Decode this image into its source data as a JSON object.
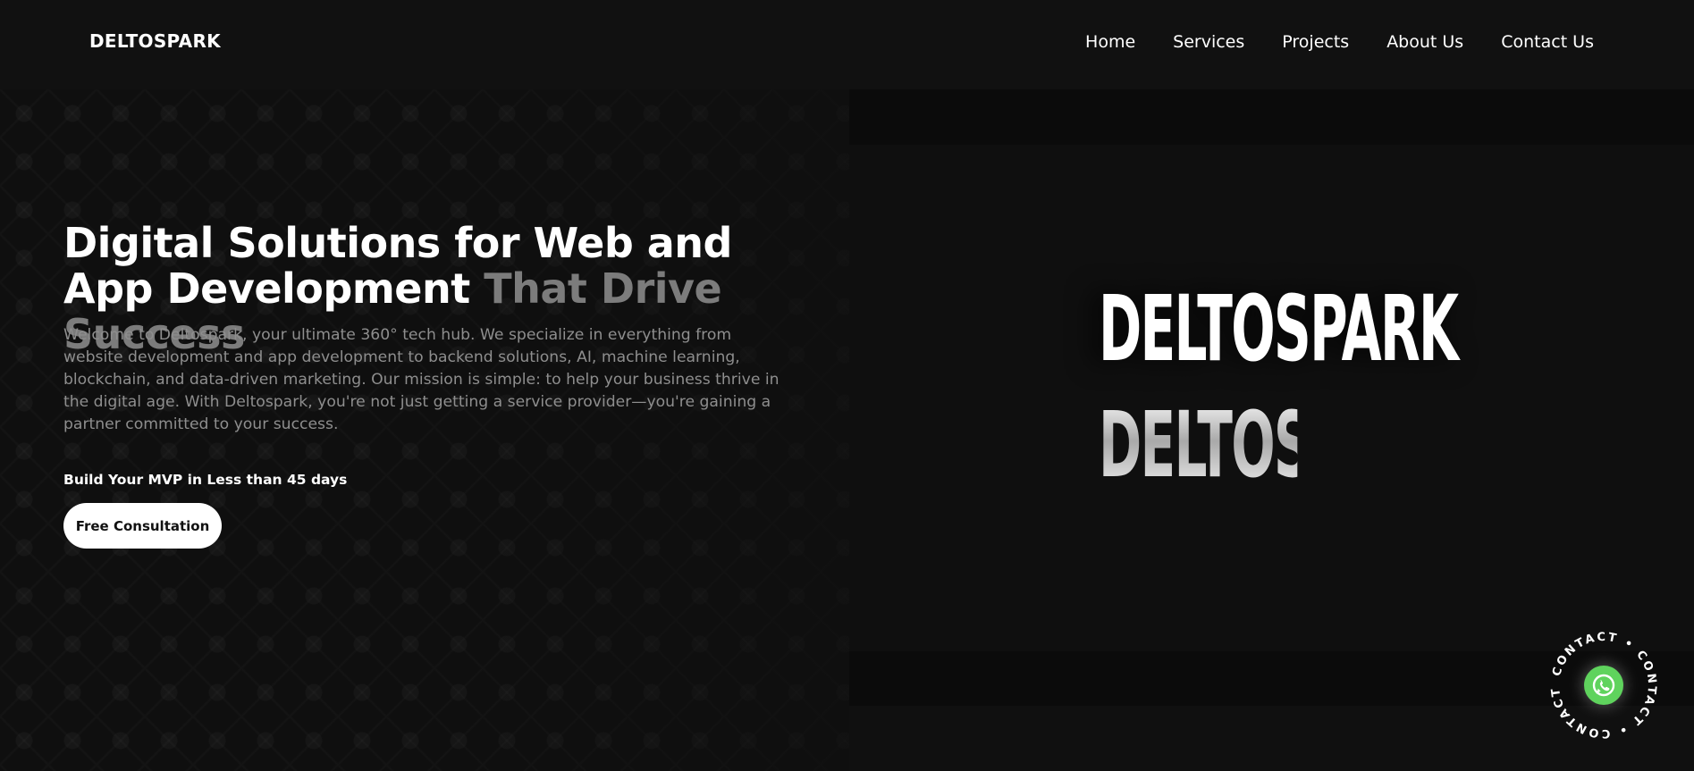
{
  "navbar": {
    "brand": "DELTOSPARK",
    "links": [
      "Home",
      "Services",
      "Projects",
      "About Us",
      "Contact Us"
    ]
  },
  "hero": {
    "headline_main": "Digital Solutions for Web and App Development",
    "headline_muted": "That Drive Success",
    "intro": "Welcome to Deltospark, your ultimate 360° tech hub. We specialize in everything from website development and app development to backend solutions, AI, machine learning, blockchain, and data-driven marketing. Our mission is simple: to help your business thrive in the digital age. With Deltospark, you're not just getting a service provider—you're gaining a partner committed to your success.",
    "mvp_label": "Build Your MVP in Less than 45 days",
    "cta_label": "Free Consultation"
  },
  "showcase": {
    "wordmark": "DELTOSPARK",
    "wordmark_reflection": "DELTOSPARK"
  },
  "contact_widget": {
    "ring_text": "CONTACT • CONTACT • CONTACT •",
    "icon": "whatsapp-icon",
    "icon_color": "#5fd35d"
  },
  "colors": {
    "background": "#101010",
    "text": "#ffffff",
    "muted_text": "#7c7c7c",
    "body_text": "#8e8e8e",
    "button_bg": "#ffffff"
  }
}
